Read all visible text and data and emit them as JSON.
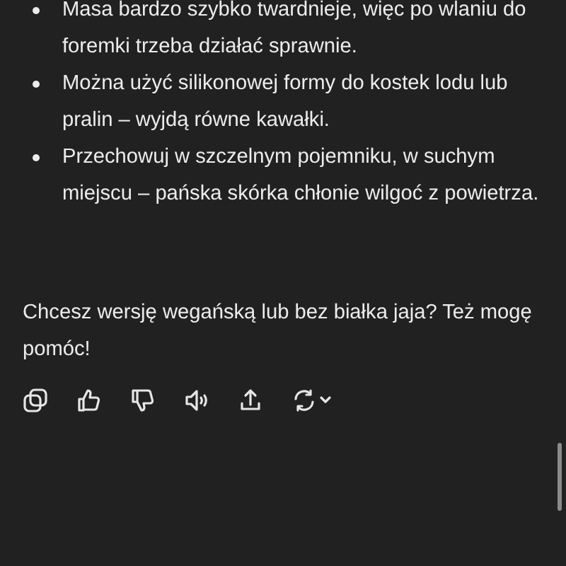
{
  "bullets": [
    "Masa bardzo szybko twardnieje, więc po wlaniu do foremki trzeba działać sprawnie.",
    "Można użyć silikonowej formy do kostek lodu lub pralin – wyjdą równe kawałki.",
    "Przechowuj w szczelnym pojemniku, w suchym miejscu – pańska skórka chłonie wilgoć z powietrza."
  ],
  "closing": "Chcesz wersję wegańską lub bez białka jaja? Też mogę pomóc!"
}
